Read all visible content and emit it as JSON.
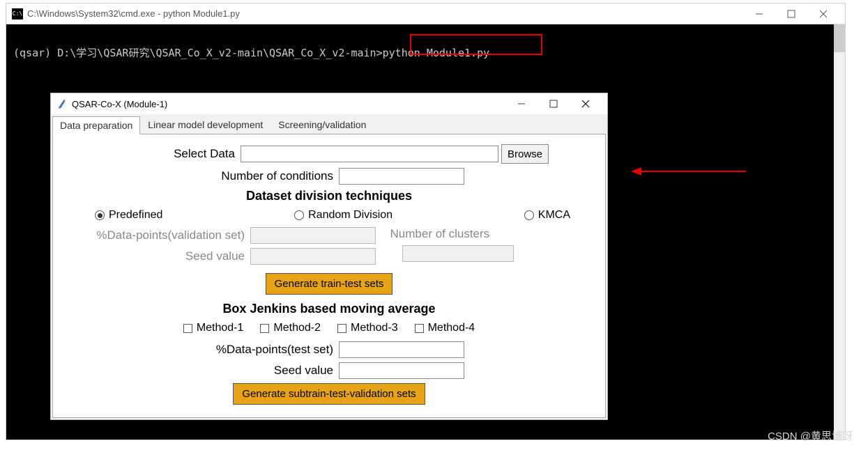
{
  "cmd": {
    "icon_text": "C:\\",
    "title": "C:\\Windows\\System32\\cmd.exe - python  Module1.py",
    "prompt": "(qsar) D:\\学习\\QSAR研究\\QSAR_Co_X_v2-main\\QSAR_Co_X_v2-main>",
    "command": "python Module1.py"
  },
  "gui": {
    "title": "QSAR-Co-X (Module-1)",
    "tabs": {
      "t0": "Data preparation",
      "t1": "Linear model development",
      "t2": "Screening/validation"
    },
    "select_data_label": "Select Data",
    "browse_btn": "Browse",
    "num_conditions_label": "Number of conditions",
    "section_division": "Dataset division techniques",
    "radio_predefined": "Predefined",
    "radio_random": "Random Division",
    "radio_kmca": "KMCA",
    "pct_validation_label": "%Data-points(validation set)",
    "num_clusters_label": "Number of clusters",
    "seed_label": "Seed value",
    "gen_train_btn": "Generate train-test sets",
    "section_box": "Box Jenkins based moving average",
    "method1": "Method-1",
    "method2": "Method-2",
    "method3": "Method-3",
    "method4": "Method-4",
    "pct_test_label": "%Data-points(test set)",
    "seed2_label": "Seed value",
    "gen_subtrain_btn": "Generate subtrain-test-validation sets"
  },
  "watermark": "CSDN @黄思博呀"
}
